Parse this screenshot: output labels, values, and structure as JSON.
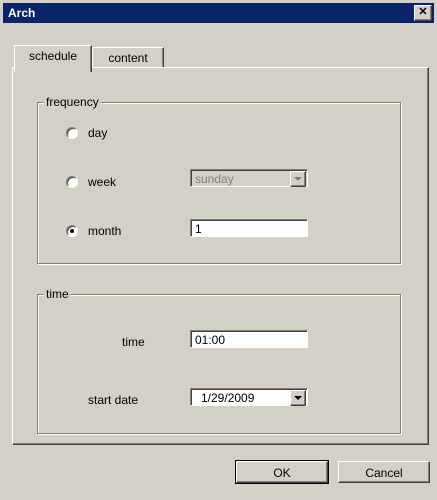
{
  "window": {
    "title": "Arch",
    "close_glyph": "✕"
  },
  "tabs": [
    {
      "label": "schedule",
      "active": true
    },
    {
      "label": "content",
      "active": false
    }
  ],
  "frequency": {
    "group_label": "frequency",
    "options": [
      {
        "label": "day",
        "checked": false
      },
      {
        "label": "week",
        "checked": false
      },
      {
        "label": "month",
        "checked": true
      }
    ],
    "week_select_value": "sunday",
    "month_value": "1"
  },
  "time_group": {
    "group_label": "time",
    "time_label": "time",
    "time_value": "01:00",
    "start_date_label": "start date",
    "start_date_value": "1/29/2009"
  },
  "buttons": {
    "ok": "OK",
    "cancel": "Cancel"
  }
}
